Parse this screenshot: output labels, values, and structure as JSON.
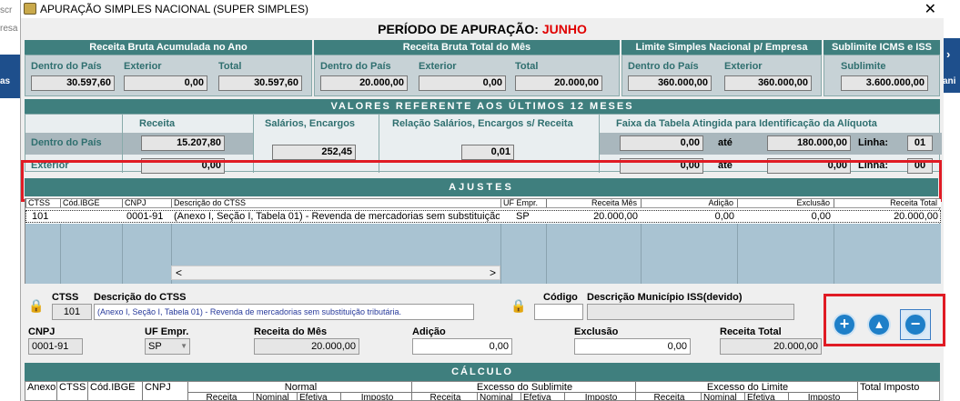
{
  "background_app": {
    "left_text_1": "scr",
    "left_text_2": "resa",
    "left_text_3": "as",
    "right_text": "ani"
  },
  "window": {
    "title": "APURAÇÃO SIMPLES NACIONAL (SUPER SIMPLES)",
    "close": "✕"
  },
  "periodo": {
    "label": "PERÍODO DE APURAÇÃO:",
    "mes": "JUNHO"
  },
  "top_sections": {
    "receita_acumulada": {
      "title": "Receita Bruta Acumulada no Ano",
      "dentro_label": "Dentro do País",
      "exterior_label": "Exterior",
      "total_label": "Total",
      "dentro": "30.597,60",
      "exterior": "0,00",
      "total": "30.597,60"
    },
    "receita_mes": {
      "title": "Receita Bruta Total do Mês",
      "dentro_label": "Dentro do País",
      "exterior_label": "Exterior",
      "total_label": "Total",
      "dentro": "20.000,00",
      "exterior": "0,00",
      "total": "20.000,00"
    },
    "limite": {
      "title": "Limite Simples Nacional p/ Empresa",
      "dentro_label": "Dentro do País",
      "exterior_label": "Exterior",
      "dentro": "360.000,00",
      "exterior": "360.000,00"
    },
    "sublimite": {
      "title": "Sublimite ICMS e ISS",
      "label": "Sublimite",
      "value": "3.600.000,00"
    }
  },
  "ultimos12": {
    "title": "VALORES REFERENTE AOS ÚLTIMOS 12 MESES",
    "col_receita": "Receita",
    "col_salarios": "Salários, Encargos",
    "col_relacao": "Relação Salários, Encargos s/ Receita",
    "col_faixa": "Faixa da Tabela Atingida para Identificação da Alíquota",
    "row_dentro": "Dentro do País",
    "row_exterior": "Exterior",
    "receita_dentro": "15.207,80",
    "receita_exterior": "0,00",
    "salarios": "252,45",
    "relacao": "0,01",
    "faixa_de_1": "0,00",
    "ate_label": "até",
    "faixa_ate_1": "180.000,00",
    "linha_label": "Linha:",
    "linha_1": "01",
    "faixa_de_2": "0,00",
    "faixa_ate_2": "0,00",
    "linha_2": "00"
  },
  "ajustes": {
    "title": "AJUSTES",
    "headers": [
      "CTSS",
      "Cód.IBGE",
      "CNPJ",
      "Descrição do CTSS",
      "UF Empr.",
      "Receita Mês",
      "Adição",
      "Exclusão",
      "Receita Total"
    ],
    "rows": [
      {
        "ctss": "101",
        "ibge": "",
        "cnpj": "0001-91",
        "descricao": "(Anexo I, Seção I, Tabela 01) - Revenda de mercadorias sem substituição",
        "uf": "SP",
        "receita_mes": "20.000,00",
        "adicao": "0,00",
        "exclusao": "0,00",
        "receita_total": "20.000,00"
      }
    ],
    "scroll_left": "<",
    "scroll_right": ">"
  },
  "form": {
    "ctss_label": "CTSS",
    "ctss_value": "101",
    "descricao_label": "Descrição do CTSS",
    "descricao_value": "(Anexo I, Seção I, Tabela 01) - Revenda de mercadorias sem substituição tributária.",
    "codigo_label": "Código",
    "codigo_value": "",
    "municipio_label": "Descrição Município ISS(devido)",
    "municipio_value": "",
    "cnpj_label": "CNPJ",
    "cnpj_value": "0001-91",
    "uf_label": "UF Empr.",
    "uf_value": "SP",
    "receita_mes_label": "Receita do Mês",
    "receita_mes_value": "20.000,00",
    "adicao_label": "Adição",
    "adicao_value": "0,00",
    "exclusao_label": "Exclusão",
    "exclusao_value": "0,00",
    "receita_total_label": "Receita Total",
    "receita_total_value": "20.000,00"
  },
  "action_buttons": {
    "add": "+",
    "up": "▲",
    "remove": "−"
  },
  "calculo": {
    "title": "CÁLCULO",
    "headers_top": [
      "Anexo",
      "CTSS",
      "Cód.IBGE",
      "CNPJ",
      "Normal",
      "Excesso do Sublimite",
      "Excesso do Limite",
      "Total Imposto"
    ],
    "headers_sub": [
      "Receita",
      "Nominal",
      "Efetiva",
      "Imposto",
      "Receita",
      "Nominal",
      "Efetiva",
      "Imposto",
      "Receita",
      "Nominal",
      "Efetiva",
      "Imposto"
    ]
  },
  "colors": {
    "teal": "#3f7f7e",
    "panel": "#c7d2d6",
    "highlight_red": "#e01b24",
    "month_red": "#e00000",
    "grid_blue": "#a9c3d2"
  }
}
